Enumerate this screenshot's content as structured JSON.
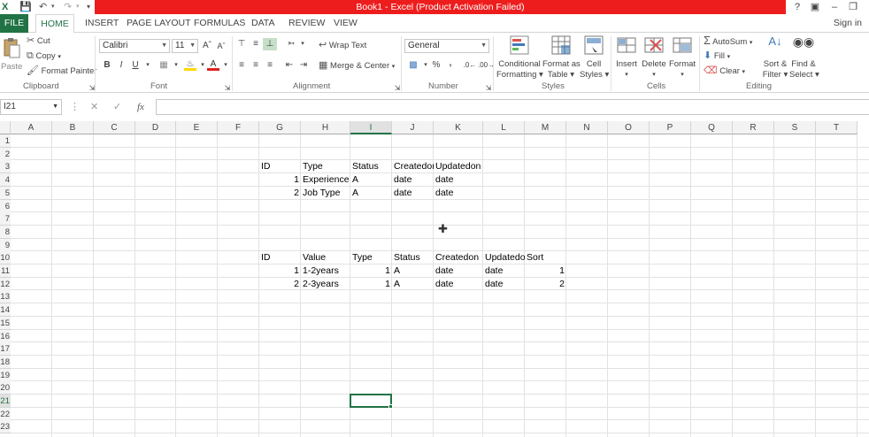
{
  "window": {
    "title": "Book1 - Excel (Product Activation Failed)",
    "help": "?",
    "signin": "Sign in"
  },
  "tabs": [
    "FILE",
    "HOME",
    "INSERT",
    "PAGE LAYOUT",
    "FORMULAS",
    "DATA",
    "REVIEW",
    "VIEW"
  ],
  "ribbon": {
    "clipboard": {
      "label": "Clipboard",
      "paste": "Paste",
      "cut": "Cut",
      "copy": "Copy",
      "format_painter": "Format Painter"
    },
    "font": {
      "label": "Font",
      "name": "Calibri",
      "size": "11",
      "bold": "B",
      "italic": "I",
      "underline": "U"
    },
    "alignment": {
      "label": "Alignment",
      "wrap_text": "Wrap Text",
      "merge_center": "Merge & Center"
    },
    "number": {
      "label": "Number",
      "format": "General",
      "percent": "%",
      "comma": ","
    },
    "styles": {
      "label": "Styles",
      "conditional": "Conditional",
      "conditional2": "Formatting",
      "format_as": "Format as",
      "format_as2": "Table",
      "cell": "Cell",
      "cell2": "Styles"
    },
    "cells": {
      "label": "Cells",
      "insert": "Insert",
      "delete": "Delete",
      "format": "Format"
    },
    "editing": {
      "label": "Editing",
      "autosum": "AutoSum",
      "fill": "Fill",
      "clear": "Clear",
      "sort": "Sort &",
      "sort2": "Filter",
      "find": "Find &",
      "find2": "Select"
    }
  },
  "formula_bar": {
    "name_box": "I21",
    "fx": "fx",
    "value": ""
  },
  "columns": [
    "A",
    "B",
    "C",
    "D",
    "E",
    "F",
    "G",
    "H",
    "I",
    "J",
    "K",
    "L",
    "M",
    "N",
    "O",
    "P",
    "Q",
    "R",
    "S",
    "T"
  ],
  "rows": [
    "1",
    "2",
    "3",
    "4",
    "5",
    "6",
    "7",
    "8",
    "9",
    "10",
    "11",
    "12",
    "13",
    "14",
    "15",
    "16",
    "17",
    "18",
    "19",
    "20",
    "21",
    "22",
    "23"
  ],
  "selected": {
    "col": "I",
    "row": "21"
  },
  "cells": [
    {
      "col": "G",
      "row": 3,
      "v": "ID"
    },
    {
      "col": "H",
      "row": 3,
      "v": "Type"
    },
    {
      "col": "I",
      "row": 3,
      "v": "Status"
    },
    {
      "col": "J",
      "row": 3,
      "v": "Createdon"
    },
    {
      "col": "K",
      "row": 3,
      "v": "Updatedon"
    },
    {
      "col": "G",
      "row": 4,
      "v": "1",
      "num": true
    },
    {
      "col": "H",
      "row": 4,
      "v": "Experience"
    },
    {
      "col": "I",
      "row": 4,
      "v": "A"
    },
    {
      "col": "J",
      "row": 4,
      "v": "date"
    },
    {
      "col": "K",
      "row": 4,
      "v": "date"
    },
    {
      "col": "G",
      "row": 5,
      "v": "2",
      "num": true
    },
    {
      "col": "H",
      "row": 5,
      "v": "Job Type"
    },
    {
      "col": "I",
      "row": 5,
      "v": "A"
    },
    {
      "col": "J",
      "row": 5,
      "v": "date"
    },
    {
      "col": "K",
      "row": 5,
      "v": "date"
    },
    {
      "col": "G",
      "row": 10,
      "v": "ID"
    },
    {
      "col": "H",
      "row": 10,
      "v": "Value"
    },
    {
      "col": "I",
      "row": 10,
      "v": "Type"
    },
    {
      "col": "J",
      "row": 10,
      "v": "Status"
    },
    {
      "col": "K",
      "row": 10,
      "v": "Createdon"
    },
    {
      "col": "L",
      "row": 10,
      "v": "Updatedo"
    },
    {
      "col": "M",
      "row": 10,
      "v": "Sort"
    },
    {
      "col": "G",
      "row": 11,
      "v": "1",
      "num": true
    },
    {
      "col": "H",
      "row": 11,
      "v": "1-2years"
    },
    {
      "col": "I",
      "row": 11,
      "v": "1",
      "num": true
    },
    {
      "col": "J",
      "row": 11,
      "v": "A"
    },
    {
      "col": "K",
      "row": 11,
      "v": "date"
    },
    {
      "col": "L",
      "row": 11,
      "v": "date"
    },
    {
      "col": "M",
      "row": 11,
      "v": "1",
      "num": true
    },
    {
      "col": "G",
      "row": 12,
      "v": "2",
      "num": true
    },
    {
      "col": "H",
      "row": 12,
      "v": "2-3years"
    },
    {
      "col": "I",
      "row": 12,
      "v": "1",
      "num": true
    },
    {
      "col": "J",
      "row": 12,
      "v": "A"
    },
    {
      "col": "K",
      "row": 12,
      "v": "date"
    },
    {
      "col": "L",
      "row": 12,
      "v": "date"
    },
    {
      "col": "M",
      "row": 12,
      "v": "2",
      "num": true
    }
  ],
  "colors": {
    "excel_green": "#217346",
    "title_red": "#ee1d1d"
  }
}
